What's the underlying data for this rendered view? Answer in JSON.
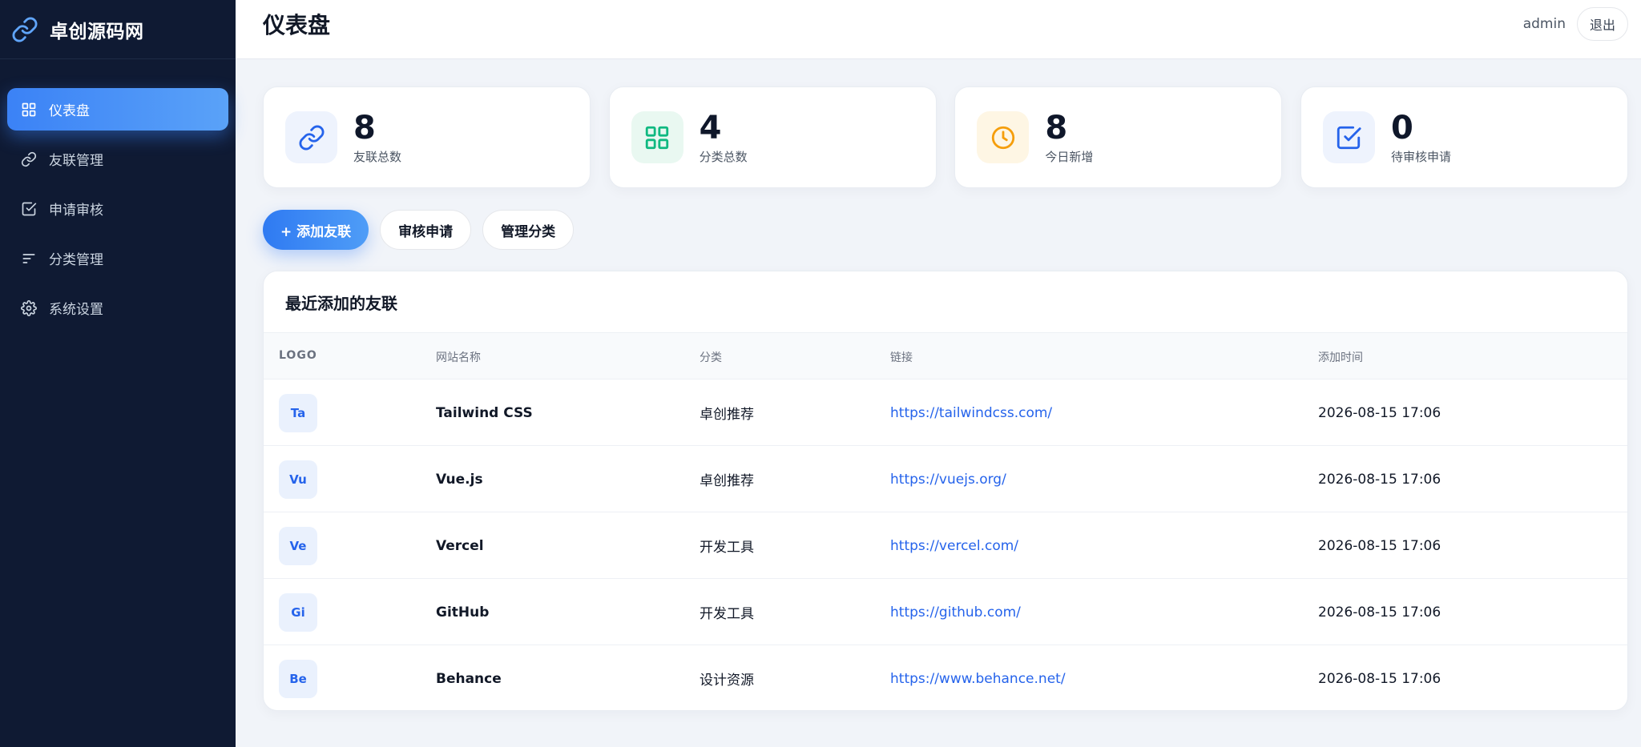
{
  "brand": {
    "name": "卓创源码网",
    "icon": "link-icon"
  },
  "sidebar": {
    "items": [
      {
        "label": "仪表盘",
        "icon": "grid-icon",
        "active": true
      },
      {
        "label": "友联管理",
        "icon": "link-icon",
        "active": false
      },
      {
        "label": "申请审核",
        "icon": "checkbox-icon",
        "active": false
      },
      {
        "label": "分类管理",
        "icon": "filter-lines-icon",
        "active": false
      },
      {
        "label": "系统设置",
        "icon": "gear-icon",
        "active": false
      }
    ]
  },
  "header": {
    "title": "仪表盘",
    "user": "admin",
    "logout_label": "退出"
  },
  "stats": [
    {
      "value": "8",
      "label": "友联总数",
      "icon": "link-icon",
      "color": "#2563eb",
      "bg": "#eef3fd"
    },
    {
      "value": "4",
      "label": "分类总数",
      "icon": "grid-icon",
      "color": "#10b981",
      "bg": "#e9f8f1"
    },
    {
      "value": "8",
      "label": "今日新增",
      "icon": "clock-icon",
      "color": "#f59e0b",
      "bg": "#fef6e4"
    },
    {
      "value": "0",
      "label": "待审核申请",
      "icon": "checkbox-icon",
      "color": "#2563eb",
      "bg": "#eef3fd"
    }
  ],
  "actions": {
    "add_label": "+ 添加友联",
    "review_label": "审核申请",
    "category_label": "管理分类"
  },
  "table": {
    "title": "最近添加的友联",
    "columns": [
      "LOGO",
      "网站名称",
      "分类",
      "链接",
      "添加时间"
    ],
    "rows": [
      {
        "logo": "Ta",
        "name": "Tailwind CSS",
        "category": "卓创推荐",
        "url": "https://tailwindcss.com/",
        "time": "2026-08-15 17:06"
      },
      {
        "logo": "Vu",
        "name": "Vue.js",
        "category": "卓创推荐",
        "url": "https://vuejs.org/",
        "time": "2026-08-15 17:06"
      },
      {
        "logo": "Ve",
        "name": "Vercel",
        "category": "开发工具",
        "url": "https://vercel.com/",
        "time": "2026-08-15 17:06"
      },
      {
        "logo": "Gi",
        "name": "GitHub",
        "category": "开发工具",
        "url": "https://github.com/",
        "time": "2026-08-15 17:06"
      },
      {
        "logo": "Be",
        "name": "Behance",
        "category": "设计资源",
        "url": "https://www.behance.net/",
        "time": "2026-08-15 17:06"
      }
    ]
  }
}
